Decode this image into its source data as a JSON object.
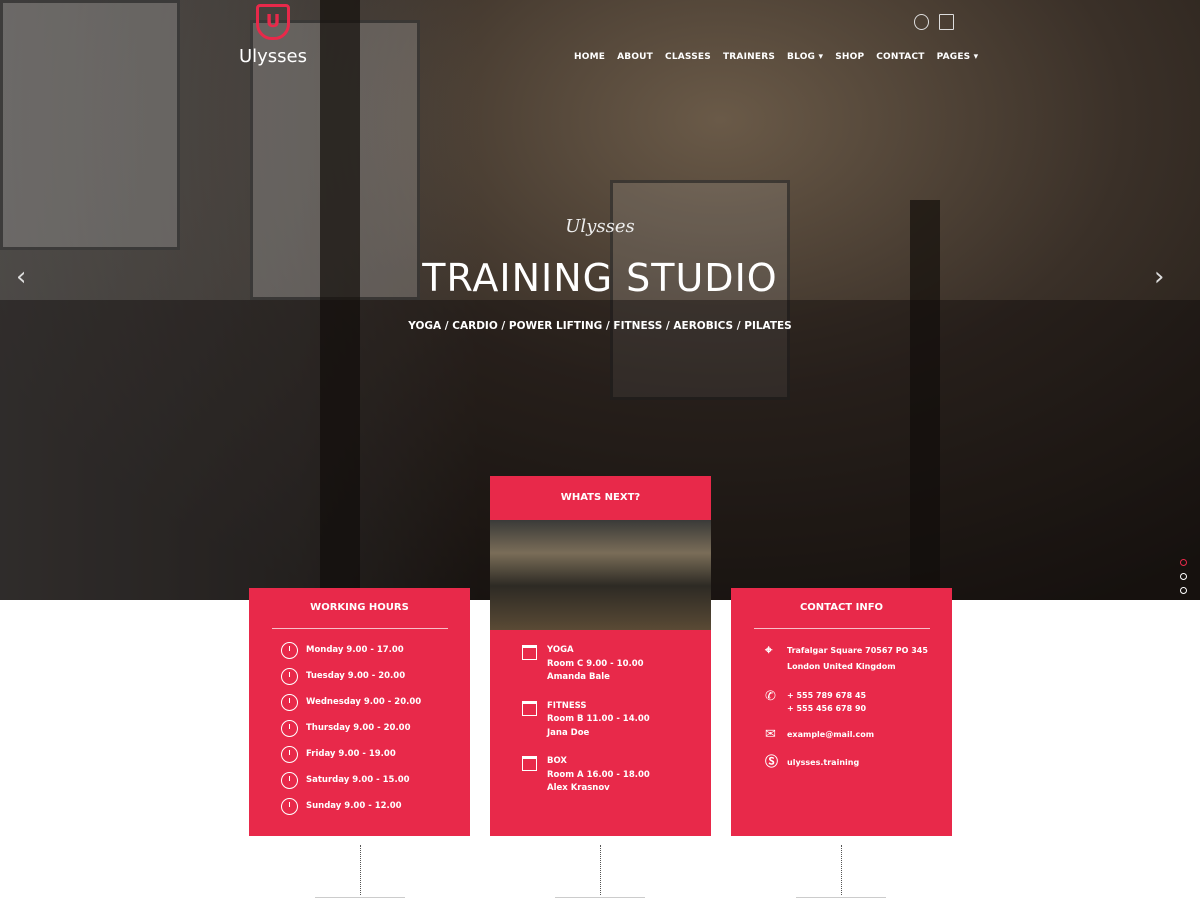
{
  "brand": {
    "name": "Ulysses",
    "logo_letter": "U",
    "accent": "#e8294a"
  },
  "nav": {
    "items": [
      "HOME",
      "ABOUT",
      "CLASSES",
      "TRAINERS",
      "BLOG ▾",
      "SHOP",
      "CONTACT",
      "PAGES ▾"
    ]
  },
  "hero": {
    "subtitle": "Ulysses",
    "title": "TRAINING STUDIO",
    "tags": "YOGA / CARDIO / POWER LIFTING / FITNESS / AEROBICS / PILATES",
    "prev": "‹",
    "next": "›",
    "slides": 3,
    "active_slide": 1
  },
  "working_hours": {
    "title": "WORKING HOURS",
    "rows": [
      "Monday 9.00 - 17.00",
      "Tuesday 9.00 - 20.00",
      "Wednesday 9.00 - 20.00",
      "Thursday 9.00 - 20.00",
      "Friday 9.00 - 19.00",
      "Saturday 9.00 - 15.00",
      "Sunday 9.00 - 12.00"
    ]
  },
  "whats_next": {
    "title": "WHATS NEXT?",
    "classes": [
      {
        "name": "YOGA",
        "room": "Room C 9.00 - 10.00",
        "trainer": "Amanda Bale"
      },
      {
        "name": "FITNESS",
        "room": "Room B 11.00 - 14.00",
        "trainer": "Jana Doe"
      },
      {
        "name": "BOX",
        "room": "Room A 16.00 - 18.00",
        "trainer": "Alex Krasnov"
      }
    ]
  },
  "contact": {
    "title": "CONTACT INFO",
    "address1": "Trafalgar Square 70567 PO 345",
    "address2": "London United Kingdom",
    "phone1": "+ 555 789 678 45",
    "phone2": "+ 555 456 678 90",
    "email": "example@mail.com",
    "skype": "ulysses.training"
  }
}
